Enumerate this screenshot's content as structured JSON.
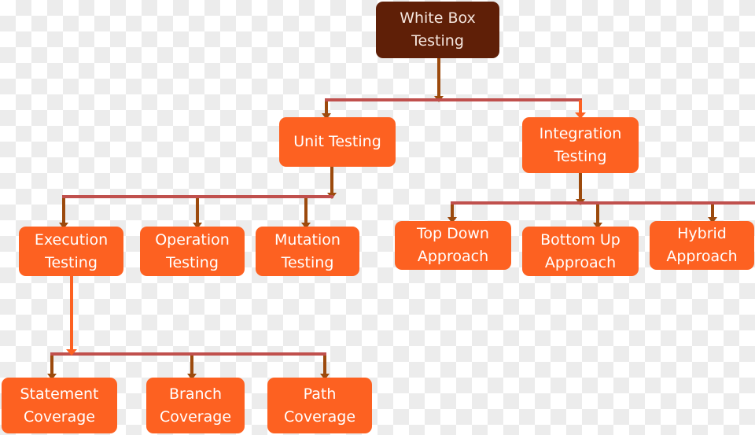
{
  "colors": {
    "root": "#5f1f07",
    "node": "#fd6121",
    "bar": "#c0504d",
    "arrow": "#9c4a0d",
    "highlight_link": "#fd6121"
  },
  "nodes": {
    "root": {
      "line1": "White Box",
      "line2": "Testing"
    },
    "unit": {
      "line1": "Unit Testing"
    },
    "integration": {
      "line1": "Integration",
      "line2": "Testing"
    },
    "execution": {
      "line1": "Execution",
      "line2": "Testing"
    },
    "operation": {
      "line1": "Operation",
      "line2": "Testing"
    },
    "mutation": {
      "line1": "Mutation",
      "line2": "Testing"
    },
    "top_down": {
      "line1": "Top Down",
      "line2": "Approach"
    },
    "bottom_up": {
      "line1": "Bottom Up",
      "line2": "Approach"
    },
    "hybrid": {
      "line1": "Hybrid",
      "line2": "Approach"
    },
    "statement": {
      "line1": "Statement",
      "line2": "Coverage"
    },
    "branch": {
      "line1": "Branch",
      "line2": "Coverage"
    },
    "path": {
      "line1": "Path",
      "line2": "Coverage"
    }
  }
}
